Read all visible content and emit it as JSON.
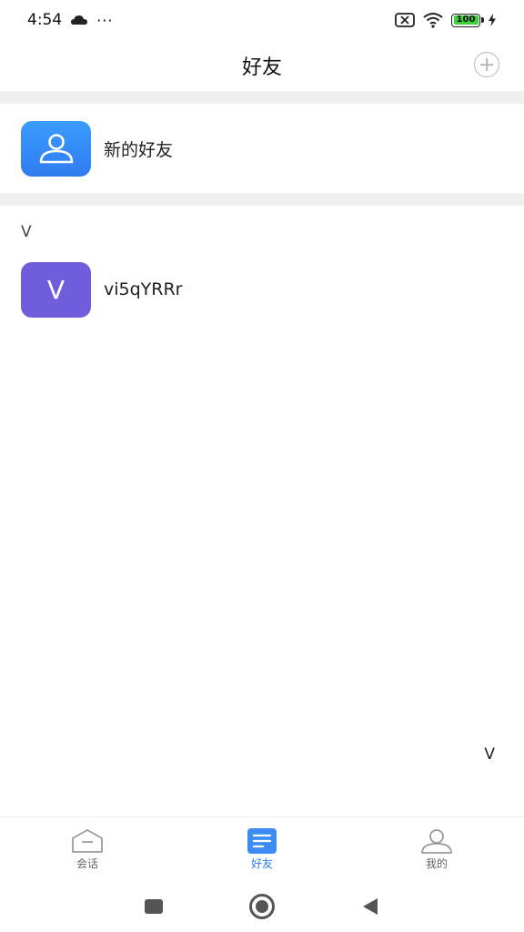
{
  "status_bar": {
    "time": "4:54",
    "dots": "···",
    "battery": "100"
  },
  "header": {
    "title": "好友"
  },
  "new_friend": {
    "label": "新的好友"
  },
  "section": {
    "letter": "V"
  },
  "contacts": [
    {
      "avatar_letter": "V",
      "name": "vi5qYRRr"
    }
  ],
  "index": {
    "letter": "V"
  },
  "tabs": [
    {
      "label": "会话",
      "icon": "chat-home-icon",
      "active": false
    },
    {
      "label": "好友",
      "icon": "contacts-list-icon",
      "active": true
    },
    {
      "label": "我的",
      "icon": "profile-icon",
      "active": false
    }
  ],
  "colors": {
    "accent": "#2f7cf0",
    "avatar_purple": "#6f5ddc",
    "divider": "#f0f0f0"
  }
}
